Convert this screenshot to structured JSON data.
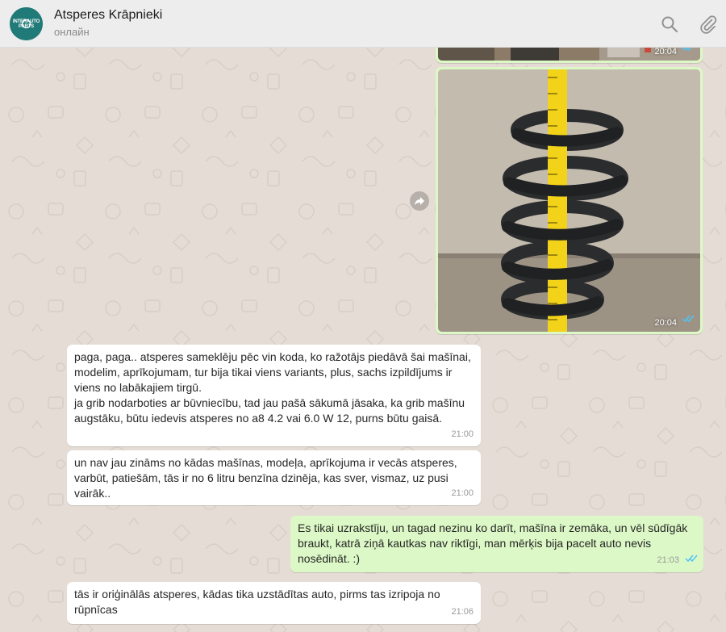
{
  "header": {
    "avatar_text": "INTERAUTO PARTS",
    "contact_name": "Atsperes Krāpnieki",
    "status": "онлайн"
  },
  "icons": {
    "search": "search-icon",
    "attach": "paperclip-icon",
    "forward": "forward-icon",
    "read": "double-check-icon"
  },
  "colors": {
    "incoming": "#ffffff",
    "outgoing": "#dcf8c6",
    "read_ticks": "#4fc3f7",
    "chat_bg": "#e5ddd5"
  },
  "messages": [
    {
      "type": "image",
      "direction": "out",
      "time": "20:04"
    },
    {
      "type": "image",
      "direction": "out",
      "time": "20:04"
    },
    {
      "type": "text",
      "direction": "in",
      "text": "paga, paga.. atsperes sameklēju pēc vin koda, ko ražotājs piedāvā šai mašīnai,\nmodelim, aprīkojumam, tur bija tikai viens variants, plus, sachs izpildījums ir\nviens no labākajiem tirgū.\nja grib nodarboties ar būvniecību, tad jau pašā sākumā jāsaka, ka grib mašīnu\naugstāku, būtu iedevis atsperes no a8 4.2 vai 6.0 W 12, purns būtu gaisā.",
      "time": "21:00"
    },
    {
      "type": "text",
      "direction": "in",
      "text": "un nav jau zināms no kādas mašīnas, modeļa, aprīkojuma ir vecās atsperes,\nvarbūt, patiešām, tās ir no 6 litru benzīna dzinēja, kas sver, vismaz, uz pusi\nvairāk..",
      "time": "21:00"
    },
    {
      "type": "text",
      "direction": "out",
      "text": "Es tikai uzrakstīju, un tagad nezinu ko darīt, mašīna ir zemāka, un vēl sūdīgāk\nbraukt, katrā ziņā kautkas nav riktīgi, man mērķis bija pacelt auto nevis\nnosēdināt. :)",
      "time": "21:03"
    },
    {
      "type": "text",
      "direction": "in",
      "text": "tās ir oriģinālās atsperes, kādas tika uzstādītas auto, pirms tas izripoja no\nrūpnīcas",
      "time": "21:06"
    }
  ]
}
